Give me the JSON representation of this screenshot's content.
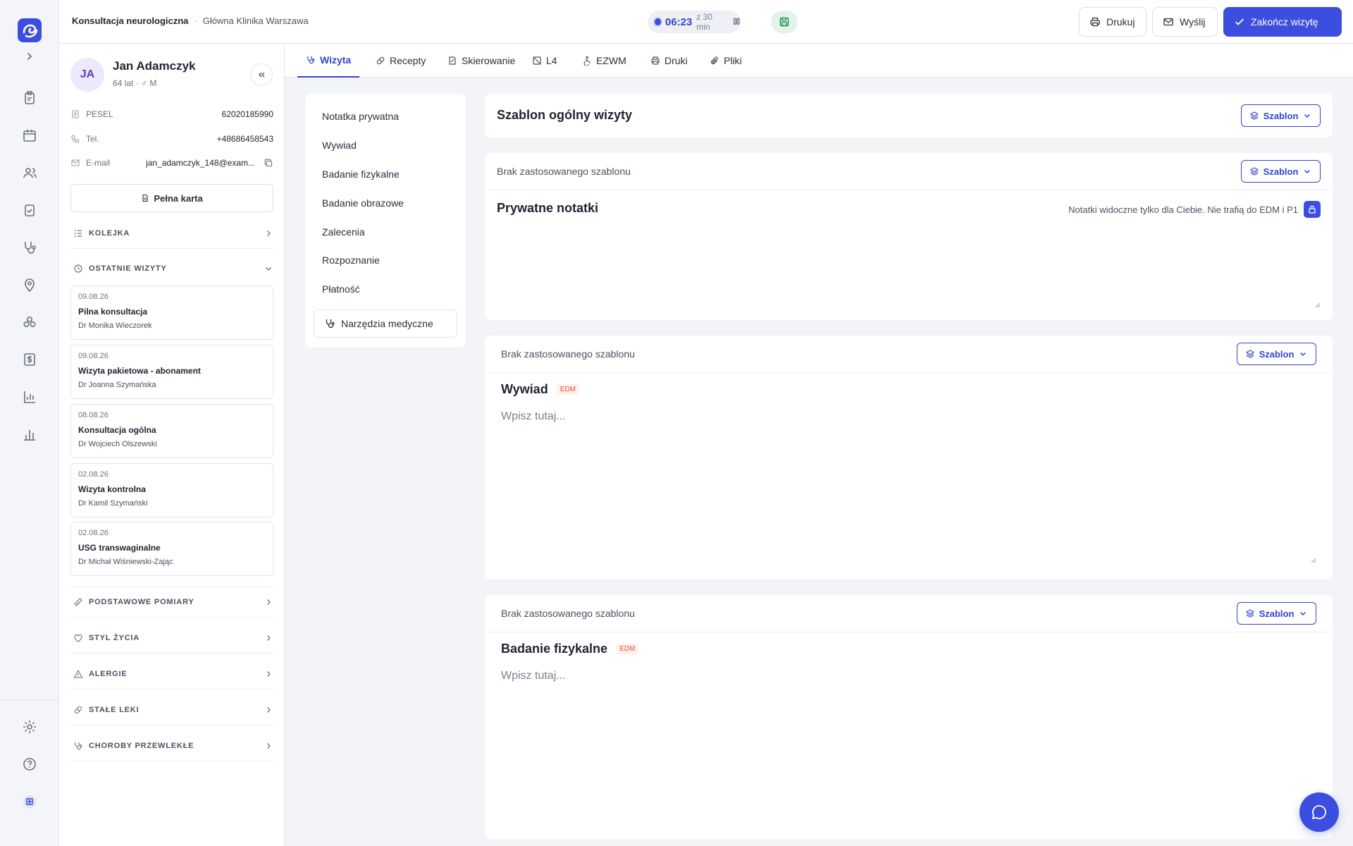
{
  "topbar": {
    "breadcrumb_visit": "Konsultacja neurologiczna",
    "breadcrumb_sep": "·",
    "breadcrumb_clinic": "Główna Klinika Warszawa",
    "timer_value": "06:23",
    "timer_total": "z 30 min",
    "print_label": "Drukuj",
    "send_label": "Wyślij",
    "finish_label": "Zakończ wizytę"
  },
  "patient": {
    "initials": "JA",
    "name": "Jan Adamczyk",
    "meta": "64 lat · ♂ M",
    "pesel_label": "PESEL",
    "pesel": "62020185990",
    "phone_label": "Tel.",
    "phone": "+48686458543",
    "email_label": "E-mail",
    "email": "jan_adamczyk_148@exam...",
    "full_card_label": "Pełna karta"
  },
  "sections": {
    "queue": "KOLEJKA",
    "recent": "OSTATNIE WIZYTY",
    "measurements": "PODSTAWOWE POMIARY",
    "lifestyle": "STYL ŻYCIA",
    "allergies": "ALERGIE",
    "meds": "STAŁE LEKI",
    "chronic": "CHOROBY PRZEWLEKŁE"
  },
  "recent_visits": [
    {
      "date": "09.08.26",
      "type": "Pilna konsultacja",
      "doctor": "Dr Monika Wieczorek"
    },
    {
      "date": "09.08.26",
      "type": "Wizyta pakietowa - abonament",
      "doctor": "Dr Joanna Szymańska"
    },
    {
      "date": "08.08.26",
      "type": "Konsultacja ogólna",
      "doctor": "Dr Wojciech Olszewski"
    },
    {
      "date": "02.08.26",
      "type": "Wizyta kontrolna",
      "doctor": "Dr Kamil Szymański"
    },
    {
      "date": "02.08.26",
      "type": "USG transwaginalne",
      "doctor": "Dr Michał Wiśniewski-Zając"
    }
  ],
  "tabs": [
    "Wizyta",
    "Recepty",
    "Skierowanie",
    "L4",
    "EZWM",
    "Druki",
    "Pliki"
  ],
  "section_nav": [
    "Notatka prywatna",
    "Wywiad",
    "Badanie fizykalne",
    "Badanie obrazowe",
    "Zalecenia",
    "Rozpoznanie",
    "Płatność"
  ],
  "tools_label": "Narzędzia medyczne",
  "main": {
    "general_template_title": "Szablon ogólny wizyty",
    "template_button": "Szablon",
    "no_template": "Brak zastosowanego szablonu",
    "private_notes_title": "Prywatne notatki",
    "private_notes_hint": "Notatki widoczne tylko dla Ciebie. Nie trafią do EDM i P1",
    "interview_title": "Wywiad",
    "physical_title": "Badanie fizykalne",
    "edm_badge": "EDM",
    "placeholder": "Wpisz tutaj..."
  },
  "colors": {
    "accent": "#3b4ee0",
    "accent_text": "#3344cc",
    "edm": "#e0573a",
    "save_green": "#1c8d52"
  }
}
